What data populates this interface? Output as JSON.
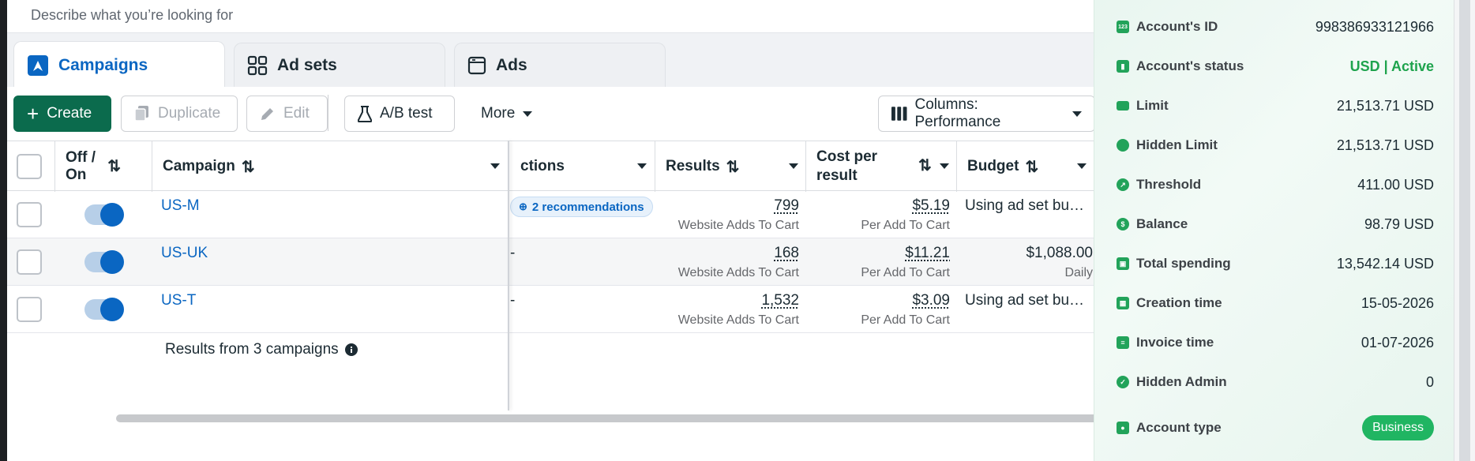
{
  "search": {
    "placeholder": "Describe what you’re looking for"
  },
  "tabs": [
    {
      "label": "Campaigns",
      "active": true
    },
    {
      "label": "Ad sets",
      "active": false
    },
    {
      "label": "Ads",
      "active": false
    }
  ],
  "toolbar": {
    "create": "Create",
    "duplicate": "Duplicate",
    "edit": "Edit",
    "ab_test": "A/B test",
    "more": "More",
    "columns": "Columns: Performance"
  },
  "table": {
    "headers": {
      "off_on": "Off / On",
      "campaign": "Campaign",
      "actions": "ctions",
      "results": "Results",
      "cost_per_result": "Cost per result",
      "budget": "Budget"
    },
    "rows": [
      {
        "name": "US-M",
        "actions": "2 recommendations",
        "results": "799",
        "results_sub": "Website Adds To Cart",
        "cost": "$5.19",
        "cost_sub": "Per Add To Cart",
        "budget": "Using ad set bu…",
        "budget_sub": ""
      },
      {
        "name": "US-UK",
        "actions": "-",
        "results": "168",
        "results_sub": "Website Adds To Cart",
        "cost": "$11.21",
        "cost_sub": "Per Add To Cart",
        "budget": "$1,088.00",
        "budget_sub": "Daily"
      },
      {
        "name": "US-T",
        "actions": "-",
        "results": "1,532",
        "results_sub": "Website Adds To Cart",
        "cost": "$3.09",
        "cost_sub": "Per Add To Cart",
        "budget": "Using ad set bu…",
        "budget_sub": ""
      }
    ],
    "footer": "Results from 3 campaigns"
  },
  "account_panel": {
    "rows": [
      {
        "label": "Account's ID",
        "value": "998386933121966",
        "icon": "id-badge-icon"
      },
      {
        "label": "Account's status",
        "value": "USD | Active",
        "icon": "bar-chart-icon"
      },
      {
        "label": "Limit",
        "value": "21,513.71 USD",
        "icon": "credit-card-icon"
      },
      {
        "label": "Hidden Limit",
        "value": "21,513.71 USD",
        "icon": "piggy-bank-icon"
      },
      {
        "label": "Threshold",
        "value": "411.00 USD",
        "icon": "trend-icon"
      },
      {
        "label": "Balance",
        "value": "98.79 USD",
        "icon": "dollar-icon"
      },
      {
        "label": "Total spending",
        "value": "13,542.14 USD",
        "icon": "receipt-icon"
      },
      {
        "label": "Creation time",
        "value": "15-05-2026",
        "icon": "calendar-icon"
      },
      {
        "label": "Invoice time",
        "value": "01-07-2026",
        "icon": "invoice-clock-icon"
      },
      {
        "label": "Hidden Admin",
        "value": "0",
        "icon": "shield-icon"
      },
      {
        "label": "Account type",
        "value": "Business",
        "icon": "person-card-icon"
      }
    ],
    "accent": "#1ea34d"
  }
}
